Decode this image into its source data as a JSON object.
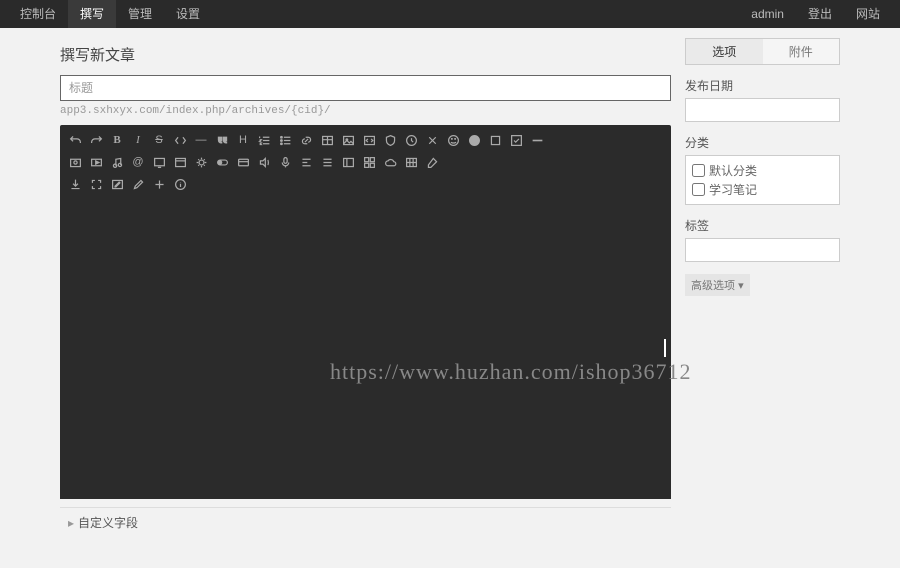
{
  "nav": {
    "left": [
      "控制台",
      "撰写",
      "管理",
      "设置"
    ],
    "active_index": 1,
    "right": [
      "admin",
      "登出",
      "网站"
    ]
  },
  "page_title": "撰写新文章",
  "title_placeholder": "标题",
  "permalink": "app3.sxhxyx.com/index.php/archives/{cid}/",
  "toolbar": {
    "row1": [
      "undo-icon",
      "redo-icon",
      "bold-icon",
      "italic-icon",
      "strike-icon",
      "code-icon",
      "quote-dash-icon",
      "quote-icon",
      "heading-icon",
      "ol-icon",
      "ul-icon",
      "link-icon",
      "table-icon",
      "image-icon",
      "codeblock-icon",
      "shield-icon",
      "clock-icon",
      "clear-icon",
      "emoji-icon",
      "face-icon",
      "square-icon",
      "check-icon",
      "hr-icon"
    ],
    "row2": [
      "photo-icon",
      "video-icon",
      "music-icon",
      "at-icon",
      "tv-icon",
      "window-icon",
      "sun-icon",
      "toggle-icon",
      "card-icon",
      "sound-icon",
      "microphone-icon",
      "align-icon",
      "bars-icon",
      "panel-icon",
      "grid-icon",
      "cloud-icon",
      "cells-icon",
      "eraser-icon"
    ],
    "row3": [
      "download-icon",
      "fullscreen-icon",
      "edit-icon",
      "pencil-icon",
      "plus-icon",
      "info-icon"
    ]
  },
  "sidebar": {
    "tabs": [
      "选项",
      "附件"
    ],
    "active_tab": 0,
    "date_label": "发布日期",
    "category_label": "分类",
    "categories": [
      "默认分类",
      "学习笔记"
    ],
    "tags_label": "标签",
    "advanced_label": "高级选项 "
  },
  "custom_fields_label": "自定义字段",
  "watermark": "https://www.huzhan.com/ishop36712"
}
